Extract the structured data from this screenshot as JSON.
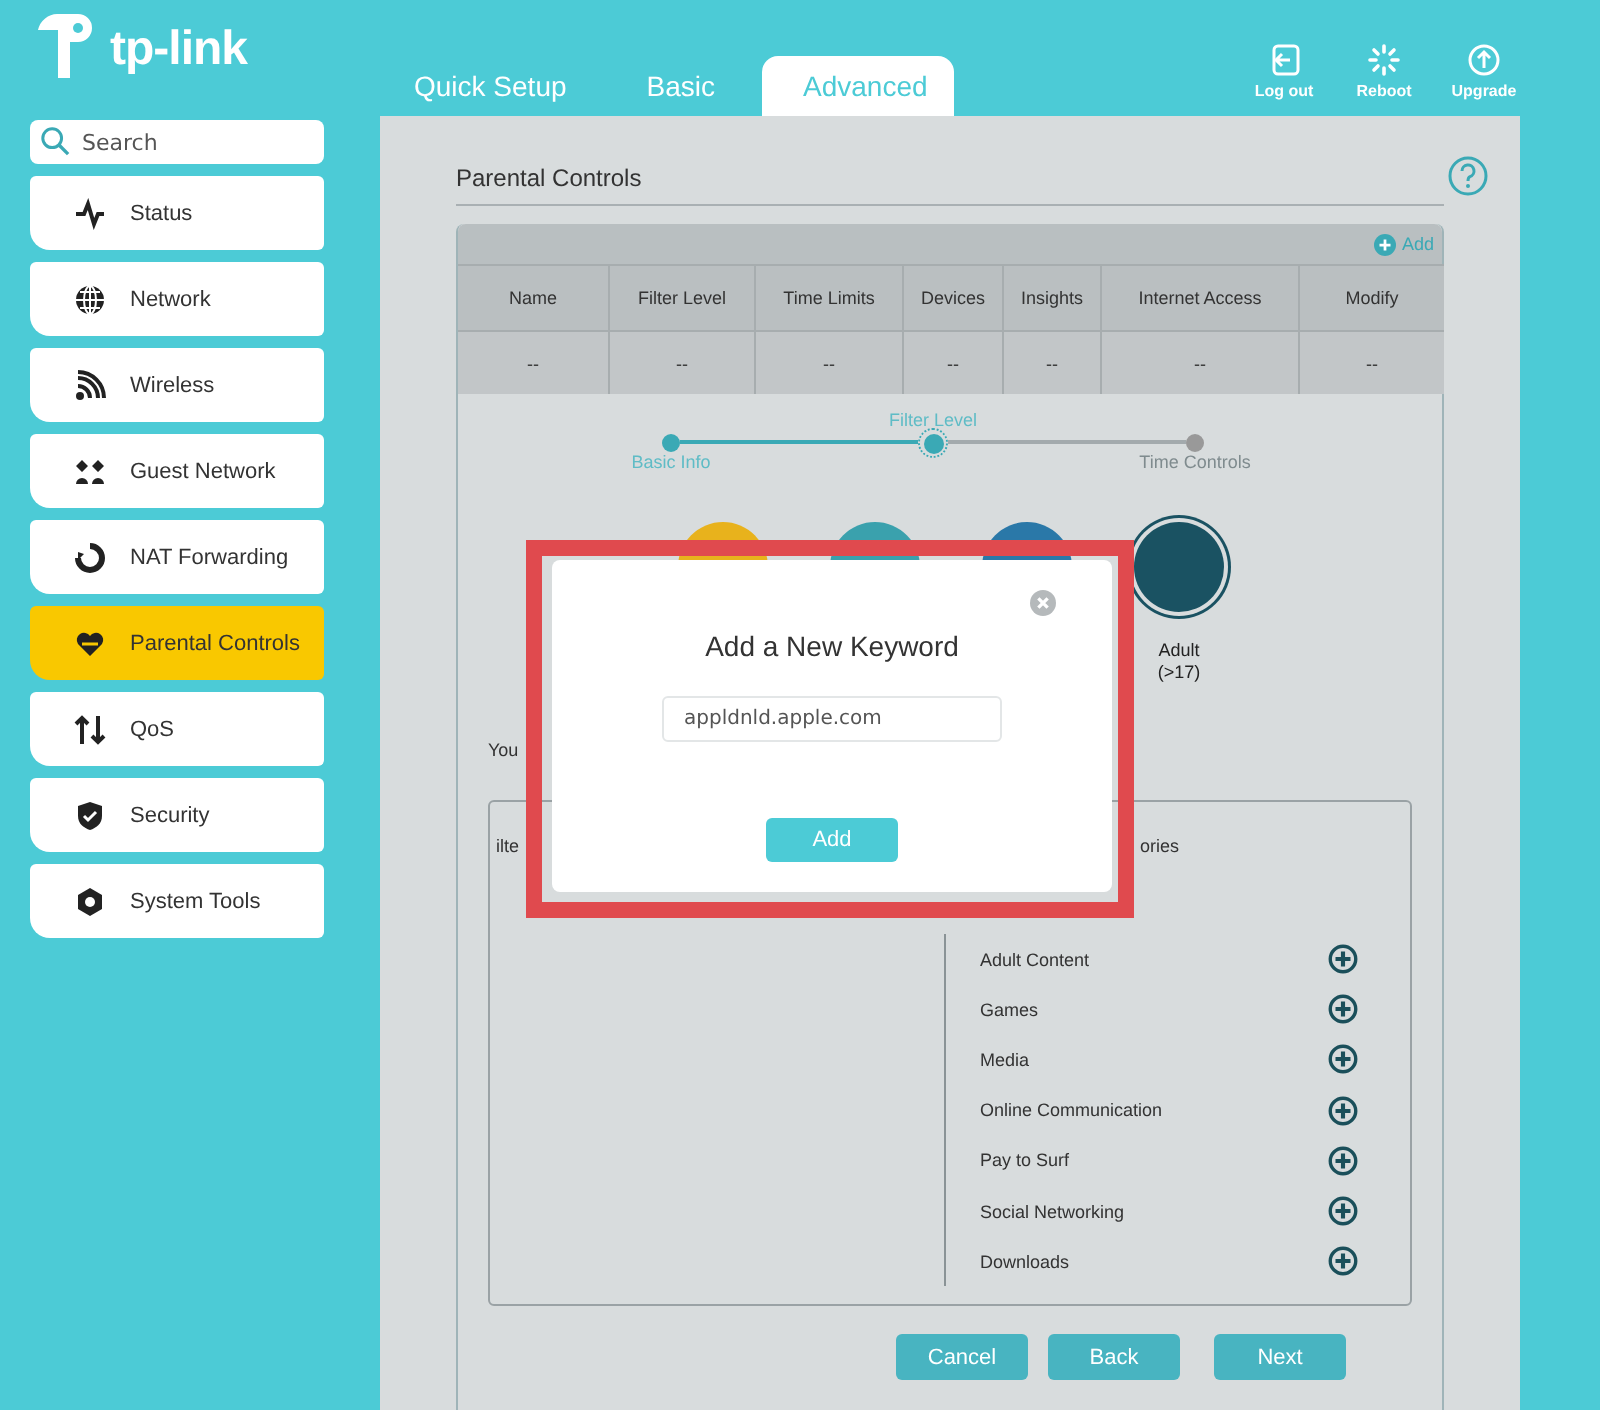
{
  "header": {
    "logo": "tp-link",
    "tabs": [
      {
        "label": "Quick Setup",
        "selected": false
      },
      {
        "label": "Basic",
        "selected": false
      },
      {
        "label": "Advanced",
        "selected": true
      }
    ],
    "actions": [
      {
        "label": "Log out"
      },
      {
        "label": "Reboot"
      },
      {
        "label": "Upgrade"
      }
    ]
  },
  "sidebar": {
    "search": {
      "placeholder": "Search"
    },
    "items": [
      {
        "label": "Status",
        "selected": false
      },
      {
        "label": "Network",
        "selected": false
      },
      {
        "label": "Wireless",
        "selected": false
      },
      {
        "label": "Guest Network",
        "selected": false
      },
      {
        "label": "NAT Forwarding",
        "selected": false
      },
      {
        "label": "Parental Controls",
        "selected": true
      },
      {
        "label": "QoS",
        "selected": false
      },
      {
        "label": "Security",
        "selected": false
      },
      {
        "label": "System Tools",
        "selected": false
      }
    ]
  },
  "page": {
    "title": "Parental Controls",
    "add_label": "Add",
    "table": {
      "columns": [
        "Name",
        "Filter Level",
        "Time Limits",
        "Devices",
        "Insights",
        "Internet Access",
        "Modify"
      ],
      "rows": [
        [
          "--",
          "--",
          "--",
          "--",
          "--",
          "--",
          "--"
        ]
      ]
    },
    "steps": [
      {
        "label": "Basic Info",
        "completed": true,
        "selected": false
      },
      {
        "label": "Filter Level",
        "completed": false,
        "selected": true
      },
      {
        "label": "Time Controls",
        "completed": false,
        "selected": false
      }
    ],
    "filter_levels": [
      {
        "color": "#e8b21c",
        "selected": false
      },
      {
        "color": "#3aa1ad",
        "selected": false
      },
      {
        "color": "#2a78a8",
        "selected": false
      },
      {
        "color": "#1a5262",
        "selected": true,
        "label": "Adult",
        "sublabel": "(>17)"
      }
    ],
    "note": "You",
    "filter_box": {
      "left_heading": "ilte",
      "right_heading": "ories",
      "categories": [
        "Adult Content",
        "Games",
        "Media",
        "Online Communication",
        "Pay to Surf",
        "Social Networking",
        "Downloads"
      ]
    },
    "buttons": [
      "Cancel",
      "Back",
      "Next"
    ]
  },
  "dialog": {
    "title": "Add a New Keyword",
    "value": "appldnld.apple.com",
    "button": "Add"
  }
}
